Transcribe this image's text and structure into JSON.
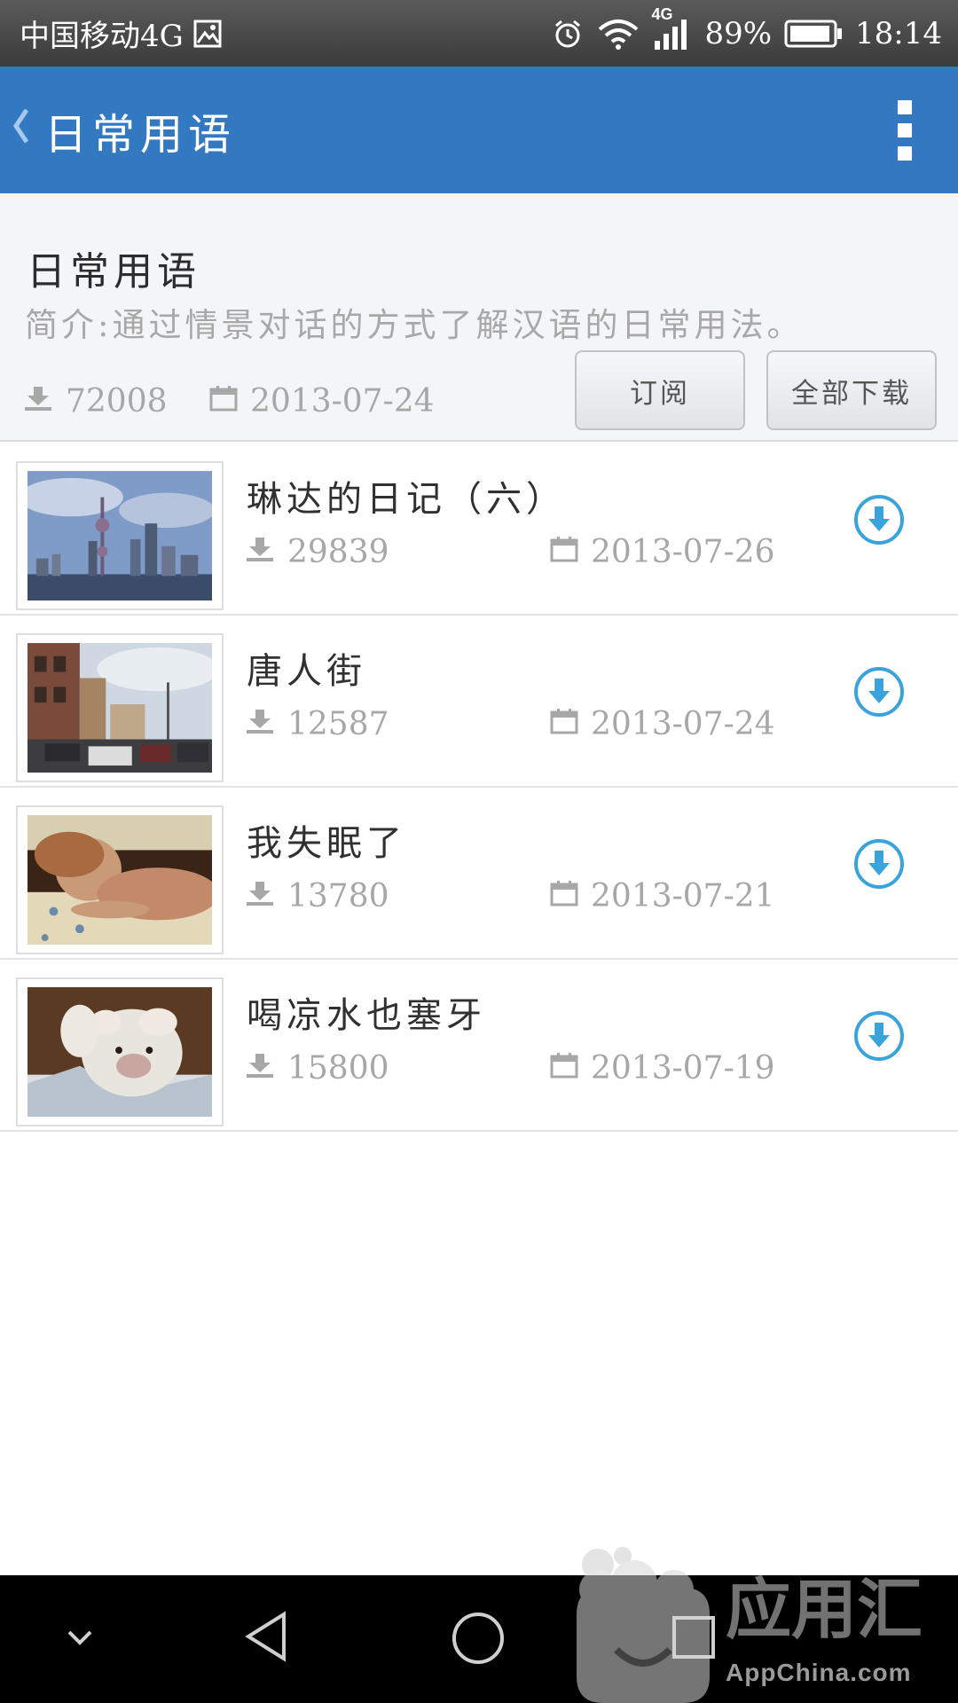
{
  "status_bar": {
    "carrier": "中国移动4G",
    "network": "4G",
    "battery": "89%",
    "time": "18:14",
    "icons": [
      "image-icon",
      "alarm-icon",
      "wifi-icon",
      "signal-icon",
      "battery-icon"
    ]
  },
  "app_bar": {
    "title": "日常用语",
    "back_icon": "chevron-left-icon",
    "menu_icon": "overflow-menu-icon"
  },
  "header": {
    "title": "日常用语",
    "intro": "简介:通过情景对话的方式了解汉语的日常用法。",
    "downloads": "72008",
    "date": "2013-07-24",
    "subscribe_label": "订阅",
    "download_all_label": "全部下载"
  },
  "lessons": [
    {
      "title": "琳达的日记（六）",
      "downloads": "29839",
      "date": "2013-07-26",
      "thumbnail": "city-skyline"
    },
    {
      "title": "唐人街",
      "downloads": "12587",
      "date": "2013-07-24",
      "thumbnail": "street"
    },
    {
      "title": "我失眠了",
      "downloads": "13780",
      "date": "2013-07-21",
      "thumbnail": "woman-pillow"
    },
    {
      "title": "喝凉水也塞牙",
      "downloads": "15800",
      "date": "2013-07-19",
      "thumbnail": "bulldog"
    }
  ],
  "colors": {
    "app_bar": "#3379c2",
    "header_bg": "#f4f5f7",
    "download_accent": "#3aa3dc",
    "meta_text": "#a7a7a7"
  },
  "watermark": {
    "text": "AppChina.com",
    "brand": "应用汇"
  }
}
